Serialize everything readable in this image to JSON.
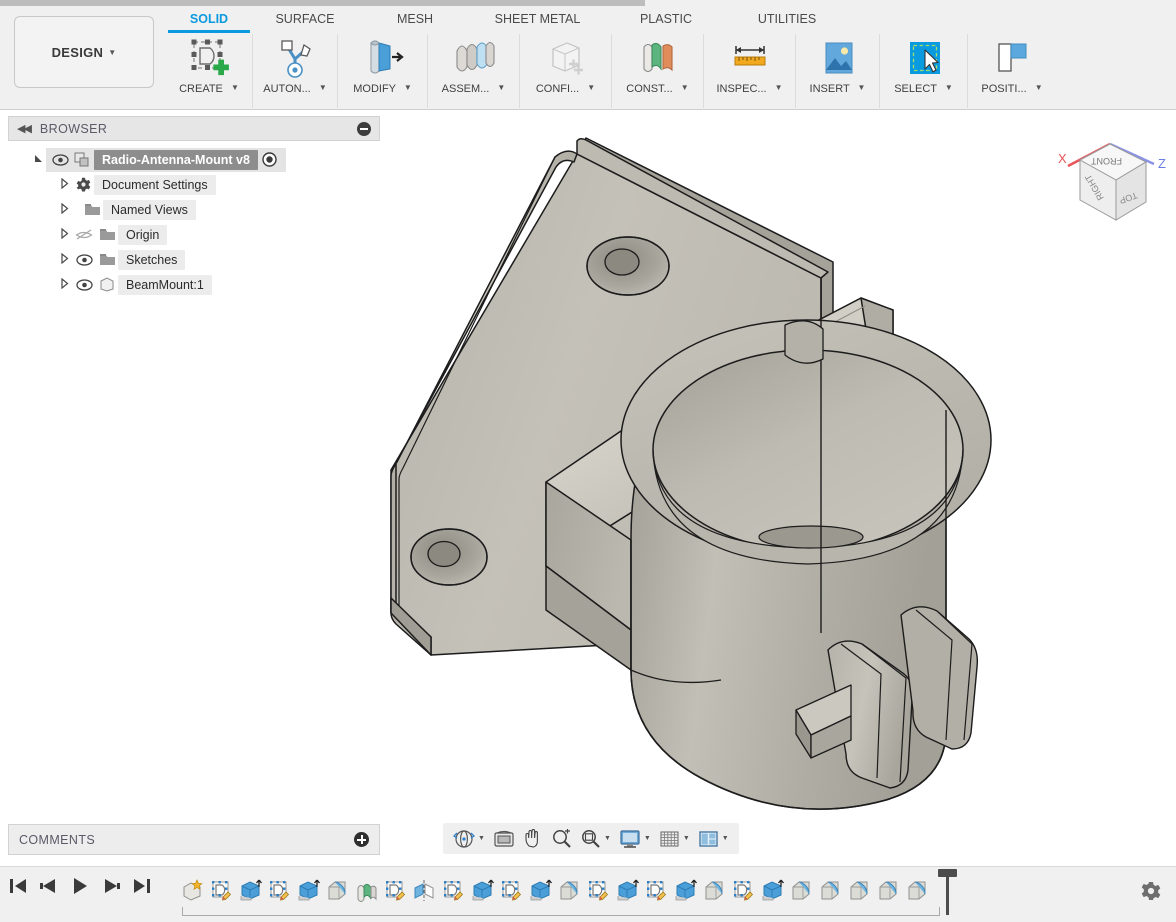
{
  "app": {
    "workspace_label": "DESIGN",
    "active_tab": "SOLID"
  },
  "ribbon": {
    "tabs": [
      {
        "label": "SOLID",
        "active": true
      },
      {
        "label": "SURFACE",
        "active": false
      },
      {
        "label": "MESH",
        "active": false
      },
      {
        "label": "SHEET METAL",
        "active": false
      },
      {
        "label": "PLASTIC",
        "active": false
      },
      {
        "label": "UTILITIES",
        "active": false
      }
    ],
    "panels": [
      {
        "label": "CREATE",
        "icon": "create-sketch-icon",
        "has_caret": true
      },
      {
        "label": "AUTON...",
        "icon": "automate-icon",
        "has_caret": true
      },
      {
        "label": "MODIFY",
        "icon": "modify-press-pull-icon",
        "has_caret": true
      },
      {
        "label": "ASSEM...",
        "icon": "assemble-icon",
        "has_caret": true
      },
      {
        "label": "CONFI...",
        "icon": "configure-icon",
        "has_caret": true
      },
      {
        "label": "CONST...",
        "icon": "construct-plane-icon",
        "has_caret": true
      },
      {
        "label": "INSPEC...",
        "icon": "inspect-measure-icon",
        "has_caret": true
      },
      {
        "label": "INSERT",
        "icon": "insert-image-icon",
        "has_caret": true
      },
      {
        "label": "SELECT",
        "icon": "select-cursor-icon",
        "has_caret": true
      },
      {
        "label": "POSITI...",
        "icon": "position-icon",
        "has_caret": true
      }
    ]
  },
  "browser": {
    "title": "BROWSER",
    "collapse_icon": "collapse-left-icon",
    "minimize_icon": "minus-circle-icon",
    "tree": [
      {
        "label": "Radio-Antenna-Mount v8",
        "icon": "document-icon",
        "eye": "visible",
        "expanded": true,
        "selected": true,
        "has_radio": true,
        "indent": 0
      },
      {
        "label": "Document Settings",
        "icon": "gear-icon",
        "eye": "none",
        "expanded": false,
        "selected": false,
        "indent": 1
      },
      {
        "label": "Named Views",
        "icon": "folder-icon",
        "eye": "none",
        "expanded": false,
        "selected": false,
        "indent": 1
      },
      {
        "label": "Origin",
        "icon": "folder-icon",
        "eye": "hidden",
        "expanded": false,
        "selected": false,
        "indent": 1
      },
      {
        "label": "Sketches",
        "icon": "folder-icon",
        "eye": "visible",
        "expanded": false,
        "selected": false,
        "indent": 1
      },
      {
        "label": "BeamMount:1",
        "icon": "body-icon",
        "eye": "visible",
        "expanded": false,
        "selected": false,
        "indent": 1
      }
    ]
  },
  "comments": {
    "title": "COMMENTS",
    "add_icon": "plus-circle-icon"
  },
  "viewcube": {
    "faces": [
      "FRONT",
      "RIGHT",
      "TOP"
    ],
    "axes": [
      {
        "label": "X",
        "color": "#e8555a"
      },
      {
        "label": "Z",
        "color": "#6a7fe0"
      }
    ]
  },
  "navbar": {
    "items": [
      {
        "name": "orbit-icon",
        "label": "Orbit",
        "caret": true
      },
      {
        "name": "look-at-icon",
        "label": "Look At",
        "caret": false
      },
      {
        "name": "pan-hand-icon",
        "label": "Pan",
        "caret": false
      },
      {
        "name": "zoom-magnifier-icon",
        "label": "Zoom",
        "caret": false
      },
      {
        "name": "fit-magnifier-icon",
        "label": "Fit",
        "caret": true
      },
      {
        "name": "display-settings-icon",
        "label": "Display Settings",
        "caret": true
      },
      {
        "name": "grid-snaps-icon",
        "label": "Grid and Snaps",
        "caret": true
      },
      {
        "name": "viewports-icon",
        "label": "Viewports",
        "caret": true
      }
    ]
  },
  "timeline": {
    "playback": [
      {
        "name": "go-to-beginning-icon",
        "label": "Go to beginning"
      },
      {
        "name": "step-back-icon",
        "label": "Step back"
      },
      {
        "name": "play-icon",
        "label": "Play"
      },
      {
        "name": "step-forward-icon",
        "label": "Step forward"
      },
      {
        "name": "go-to-end-icon",
        "label": "Go to end"
      }
    ],
    "features": [
      {
        "type": "new-component",
        "label": "New Component"
      },
      {
        "type": "sketch",
        "label": "Sketch"
      },
      {
        "type": "extrude",
        "label": "Extrude"
      },
      {
        "type": "sketch",
        "label": "Sketch"
      },
      {
        "type": "extrude",
        "label": "Extrude"
      },
      {
        "type": "fillet",
        "label": "Fillet"
      },
      {
        "type": "construct",
        "label": "Construction Plane"
      },
      {
        "type": "sketch",
        "label": "Sketch"
      },
      {
        "type": "mirror",
        "label": "Mirror"
      },
      {
        "type": "sketch",
        "label": "Sketch"
      },
      {
        "type": "extrude",
        "label": "Extrude"
      },
      {
        "type": "sketch",
        "label": "Sketch"
      },
      {
        "type": "extrude",
        "label": "Extrude"
      },
      {
        "type": "fillet",
        "label": "Fillet"
      },
      {
        "type": "sketch",
        "label": "Sketch"
      },
      {
        "type": "extrude",
        "label": "Extrude"
      },
      {
        "type": "sketch",
        "label": "Sketch"
      },
      {
        "type": "extrude",
        "label": "Extrude"
      },
      {
        "type": "fillet",
        "label": "Fillet"
      },
      {
        "type": "sketch",
        "label": "Sketch"
      },
      {
        "type": "extrude",
        "label": "Extrude"
      },
      {
        "type": "fillet",
        "label": "Fillet"
      },
      {
        "type": "fillet",
        "label": "Fillet"
      },
      {
        "type": "fillet",
        "label": "Fillet"
      },
      {
        "type": "fillet",
        "label": "Fillet"
      },
      {
        "type": "fillet",
        "label": "Fillet"
      }
    ],
    "settings_icon": "gear-icon"
  },
  "model": {
    "name": "BeamMount",
    "description": "Radio antenna mount bracket with triangular flange plate, two countersunk mounting holes, a reinforcing rib and a split cylindrical clamp collar",
    "colors": {
      "surface_light": "#c9c6bd",
      "surface_mid": "#b9b6ad",
      "surface_dark": "#a9a69d",
      "edge": "#1c1c1c"
    }
  },
  "colors": {
    "accent": "#0a9ae0",
    "ribbon_bg": "#f0f0f0",
    "panel_bg": "#e6e6e6",
    "canvas_bg": "#ffffff",
    "selected_node": "#8d8d8d"
  }
}
